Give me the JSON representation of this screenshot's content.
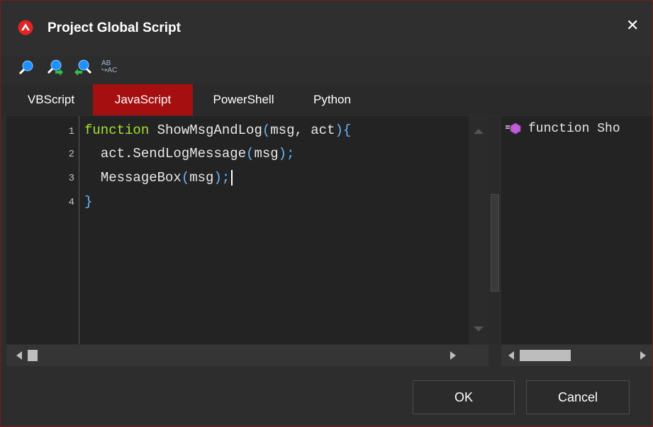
{
  "window": {
    "title": "Project Global Script"
  },
  "toolbar": {
    "icons": [
      "find-icon",
      "find-next-icon",
      "find-previous-icon",
      "replace-icon"
    ],
    "replace_label_top": "AB",
    "replace_label_bottom": "AC"
  },
  "tabs": [
    {
      "label": "VBScript",
      "active": false
    },
    {
      "label": "JavaScript",
      "active": true
    },
    {
      "label": "PowerShell",
      "active": false
    },
    {
      "label": "Python",
      "active": false
    }
  ],
  "editor": {
    "line_numbers": [
      "1",
      "2",
      "3",
      "4"
    ],
    "lines": [
      {
        "kw": "function",
        "rest": " ShowMsgAndLog",
        "p1": "(",
        "args": "msg, act",
        "p2": "){"
      },
      {
        "indent": "  ",
        "text": "act.SendLogMessage",
        "p1": "(",
        "args": "msg",
        "p2": ");"
      },
      {
        "indent": "  ",
        "text": "MessageBox",
        "p1": "(",
        "args": "msg",
        "p2": ");"
      },
      {
        "text": "}"
      }
    ]
  },
  "outline": {
    "item": "function Sho"
  },
  "buttons": {
    "ok": "OK",
    "cancel": "Cancel"
  },
  "colors": {
    "accent": "#a50f0f",
    "keyword": "#a6e22e",
    "punctuation": "#66b7ff"
  }
}
